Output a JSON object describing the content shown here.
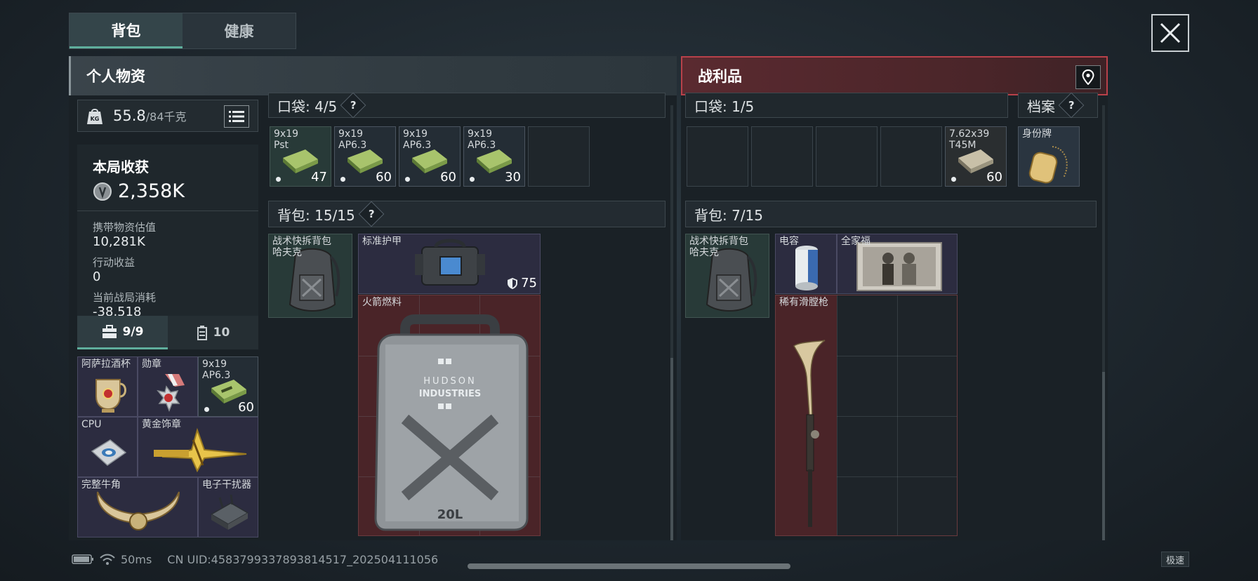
{
  "tabs": [
    {
      "label": "背包"
    },
    {
      "label": "健康"
    }
  ],
  "personal": {
    "title": "个人物资",
    "weight": {
      "current": "55.8",
      "max_unit": "/84千克",
      "icon_label": "KG"
    },
    "stats": {
      "header": "本局收获",
      "haul_value": "2,358K",
      "carried_label": "携带物资估值",
      "carried_value": "10,281K",
      "action_label": "行动收益",
      "action_value": "0",
      "cost_label": "当前战局消耗",
      "cost_value": "-38,518"
    },
    "subtabs": [
      {
        "label": "9/9",
        "icon": "briefcase-icon"
      },
      {
        "label": "10",
        "icon": "canister-icon"
      }
    ],
    "safebox_items": [
      {
        "name": "阿萨拉酒杯"
      },
      {
        "name": "勋章"
      },
      {
        "name": "9x19\nAP6.3",
        "count": "60"
      },
      {
        "name": "CPU"
      },
      {
        "name": "黄金饰章"
      },
      {
        "name": "完整牛角"
      },
      {
        "name": "电子干扰器"
      }
    ],
    "pocket": {
      "label": "口袋: 4/5",
      "help": "?"
    },
    "pocket_items": [
      {
        "name": "9x19\nPst",
        "count": "47"
      },
      {
        "name": "9x19\nAP6.3",
        "count": "60"
      },
      {
        "name": "9x19\nAP6.3",
        "count": "60"
      },
      {
        "name": "9x19\nAP6.3",
        "count": "30"
      }
    ],
    "backpack": {
      "label": "背包: 15/15",
      "help": "?"
    },
    "backpack_items": [
      {
        "name": "战术快拆背包\n哈夫克"
      },
      {
        "name": "标准护甲",
        "durability": "75"
      },
      {
        "name": "火箭燃料",
        "can_text_1": "HUDSON",
        "can_text_2": "INDUSTRIES",
        "can_size": "20L"
      }
    ]
  },
  "loot": {
    "title": "战利品",
    "pocket": {
      "label": "口袋: 1/5"
    },
    "archive": {
      "label": "档案",
      "help": "?"
    },
    "pocket_items": [
      {
        "name": "7.62x39\nT45M",
        "count": "60"
      }
    ],
    "archive_item": {
      "name": "身份牌"
    },
    "backpack": {
      "label": "背包: 7/15"
    },
    "backpack_items": [
      {
        "name": "战术快拆背包\n哈夫克"
      },
      {
        "name": "电容"
      },
      {
        "name": "全家福"
      },
      {
        "name": "稀有滑膛枪"
      }
    ]
  },
  "status": {
    "ping": "50ms",
    "uid": "CN UID:4583799337893814517_202504111056",
    "speed": "极速"
  }
}
